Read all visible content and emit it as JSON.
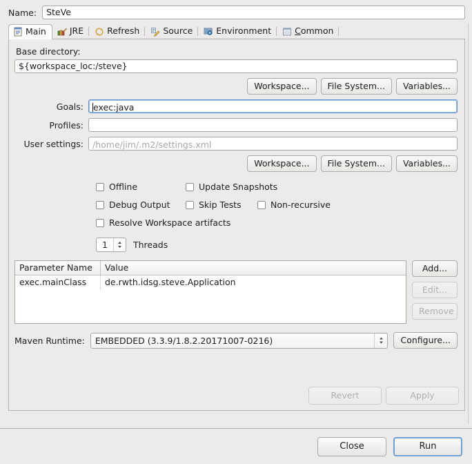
{
  "name_row": {
    "label": "Name:",
    "value": "SteVe"
  },
  "tabs": [
    {
      "label": "Main",
      "icon": "document-page-icon",
      "active": true
    },
    {
      "label": "JRE",
      "icon": "java-books-icon",
      "active": false
    },
    {
      "label": "Refresh",
      "icon": "refresh-arrows-icon",
      "active": false
    },
    {
      "label": "Source",
      "icon": "source-pencil-icon",
      "active": false
    },
    {
      "label": "Environment",
      "icon": "environment-monitor-icon",
      "active": false
    },
    {
      "label": "Common",
      "icon": "common-window-icon",
      "active": false,
      "mnemonic": "C",
      "rest": "ommon"
    }
  ],
  "main": {
    "base_directory": {
      "label": "Base directory:",
      "value": "${workspace_loc:/steve}"
    },
    "dir_buttons": [
      {
        "label": "Workspace...",
        "enabled": true
      },
      {
        "label": "File System...",
        "enabled": true
      },
      {
        "label": "Variables...",
        "enabled": true
      }
    ],
    "goals": {
      "label": "Goals:",
      "value": "exec:java",
      "focused": true
    },
    "profiles": {
      "label": "Profiles:",
      "value": ""
    },
    "user_settings": {
      "label": "User settings:",
      "value": "",
      "placeholder": "/home/jim/.m2/settings.xml"
    },
    "settings_buttons": [
      {
        "label": "Workspace...",
        "enabled": true
      },
      {
        "label": "File System...",
        "enabled": true
      },
      {
        "label": "Variables...",
        "enabled": true
      }
    ],
    "checkbox_rows": [
      [
        {
          "label": "Offline",
          "checked": false,
          "name": "offline"
        },
        {
          "label": "Update Snapshots",
          "checked": false,
          "name": "update-snapshots"
        }
      ],
      [
        {
          "label": "Debug Output",
          "checked": false,
          "name": "debug-output"
        },
        {
          "label": "Skip Tests",
          "checked": false,
          "name": "skip-tests"
        },
        {
          "label": "Non-recursive",
          "checked": false,
          "name": "non-recursive"
        }
      ],
      [
        {
          "label": "Resolve Workspace artifacts",
          "checked": false,
          "name": "resolve-workspace-artifacts"
        }
      ]
    ],
    "threads": {
      "value": "1",
      "label": "Threads"
    },
    "parameters_table": {
      "columns": [
        "Parameter Name",
        "Value"
      ],
      "rows": [
        {
          "name": "exec.mainClass",
          "value": "de.rwth.idsg.steve.Application"
        }
      ],
      "buttons": [
        {
          "label": "Add...",
          "enabled": true
        },
        {
          "label": "Edit...",
          "enabled": false
        },
        {
          "label": "Remove",
          "enabled": false
        }
      ]
    },
    "maven_runtime": {
      "label": "Maven Runtime:",
      "selected": "EMBEDDED (3.3.9/1.8.2.20171007-0216)",
      "configure_label": "Configure..."
    },
    "revert": {
      "label": "Revert",
      "enabled": false
    },
    "apply": {
      "label": "Apply",
      "enabled": false
    }
  },
  "bottom_bar": {
    "close": {
      "label": "Close",
      "enabled": true,
      "default": false
    },
    "run": {
      "label": "Run",
      "enabled": true,
      "default": true
    }
  },
  "colors": {
    "window_background": "#edebe9",
    "field_background": "#ffffff",
    "focus_border": "#5b8fd0",
    "text": "#1d1d1d",
    "disabled_text": "#b0aeab",
    "border": "#a8a6a3"
  }
}
